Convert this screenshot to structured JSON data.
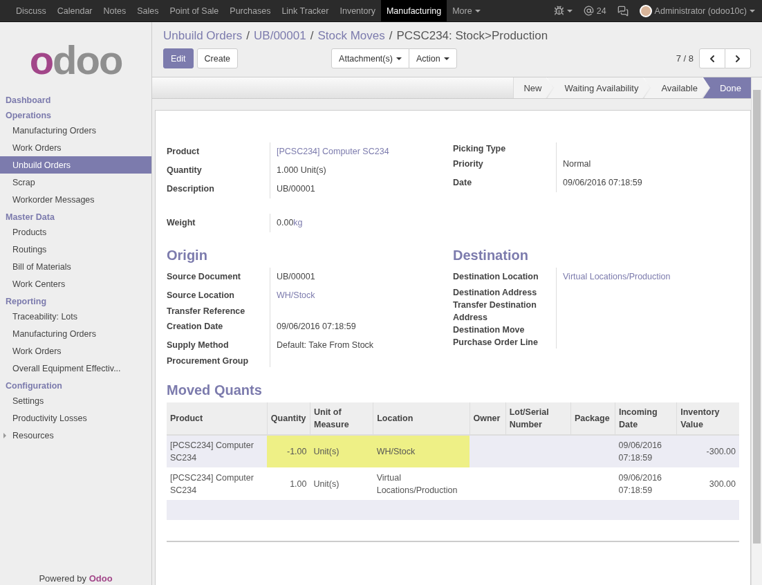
{
  "top_menu": [
    {
      "label": "Discuss",
      "selected": false
    },
    {
      "label": "Calendar",
      "selected": false
    },
    {
      "label": "Notes",
      "selected": false
    },
    {
      "label": "Sales",
      "selected": false
    },
    {
      "label": "Point of Sale",
      "selected": false
    },
    {
      "label": "Purchases",
      "selected": false
    },
    {
      "label": "Link Tracker",
      "selected": false
    },
    {
      "label": "Inventory",
      "selected": false
    },
    {
      "label": "Manufacturing",
      "selected": true
    },
    {
      "label": "More",
      "selected": false
    }
  ],
  "systray": {
    "mentions": "24",
    "user": "Administrator (odoo10c)"
  },
  "logo": "odoo",
  "sidebar": [
    {
      "title": "Dashboard"
    },
    {
      "title": "Operations",
      "items": [
        {
          "label": "Manufacturing Orders",
          "selected": false
        },
        {
          "label": "Work Orders",
          "selected": false
        },
        {
          "label": "Unbuild Orders",
          "selected": true
        },
        {
          "label": "Scrap",
          "selected": false
        },
        {
          "label": "Workorder Messages",
          "selected": false
        }
      ]
    },
    {
      "title": "Master Data",
      "items": [
        {
          "label": "Products",
          "selected": false
        },
        {
          "label": "Routings",
          "selected": false
        },
        {
          "label": "Bill of Materials",
          "selected": false
        },
        {
          "label": "Work Centers",
          "selected": false
        }
      ]
    },
    {
      "title": "Reporting",
      "items": [
        {
          "label": "Traceability: Lots",
          "selected": false
        },
        {
          "label": "Manufacturing Orders",
          "selected": false
        },
        {
          "label": "Work Orders",
          "selected": false
        },
        {
          "label": "Overall Equipment Effectiv...",
          "selected": false
        }
      ]
    },
    {
      "title": "Configuration",
      "items": [
        {
          "label": "Settings",
          "selected": false
        },
        {
          "label": "Productivity Losses",
          "selected": false
        },
        {
          "label": "Resources",
          "selected": false,
          "expandable": true
        }
      ]
    }
  ],
  "powered_by": {
    "text": "Powered by",
    "brand": "Odoo"
  },
  "breadcrumb_separator": "/",
  "breadcrumb": [
    {
      "label": "Unbuild Orders",
      "link": true
    },
    {
      "label": "UB/00001",
      "link": true
    },
    {
      "label": "Stock Moves",
      "link": true
    },
    {
      "label": "PCSC234: Stock>Production",
      "link": false
    }
  ],
  "buttons": {
    "edit": "Edit",
    "create": "Create",
    "attachments": "Attachment(s)",
    "action": "Action"
  },
  "pager": "7 / 8",
  "status_steps": [
    {
      "label": "New",
      "selected": false
    },
    {
      "label": "Waiting Availability",
      "selected": false
    },
    {
      "label": "Available",
      "selected": false
    },
    {
      "label": "Done",
      "selected": true
    }
  ],
  "groups": [
    {
      "fields": [
        {
          "label": "Product",
          "value": "[PCSC234] Computer SC234",
          "link": true
        },
        {
          "label": "Quantity",
          "value": "1.000 Unit(s)",
          "link": false
        },
        {
          "label": "Description",
          "value": "UB/00001",
          "link": false
        }
      ]
    },
    {
      "fields": [
        {
          "label": "Picking Type"
        },
        {
          "label": "Priority",
          "value": "Normal",
          "link": false
        },
        {
          "label": "Date",
          "value": "09/06/2016 07:18:59",
          "link": false
        }
      ]
    },
    {
      "fields": [
        {
          "label": "Weight",
          "value": "0.00",
          "unit": "kg",
          "link": false
        }
      ]
    },
    {
      "title": "Origin",
      "fields": [
        {
          "label": "Source Document",
          "value": "UB/00001",
          "link": false
        },
        {
          "label": "Source Location",
          "value": "WH/Stock",
          "link": true
        },
        {
          "label": "Transfer Reference"
        },
        {
          "label": "Creation Date",
          "value": "09/06/2016 07:18:59",
          "link": false
        },
        {
          "label": "Supply Method",
          "value": "Default: Take From Stock",
          "link": false
        },
        {
          "label": "Procurement Group"
        }
      ]
    },
    {
      "title": "Destination",
      "fields": [
        {
          "label": "Destination Location",
          "value": "Virtual Locations/Production",
          "link": true
        },
        {
          "label": "Destination Address"
        },
        {
          "label": "Transfer Destination Address"
        },
        {
          "label": "Destination Move"
        },
        {
          "label": "Purchase Order Line"
        }
      ]
    }
  ],
  "moved_quants": {
    "title": "Moved Quants",
    "columns": [
      "Product",
      "Quantity",
      "Unit of Measure",
      "Location",
      "Owner",
      "Lot/Serial Number",
      "Package",
      "Incoming Date",
      "Inventory Value"
    ],
    "rows": [
      {
        "cells": [
          "[PCSC234] Computer SC234",
          "-1.00",
          "Unit(s)",
          "WH/Stock",
          "",
          "",
          "",
          "09/06/2016 07:18:59",
          "-300.00"
        ],
        "highlighted": true
      },
      {
        "cells": [
          "[PCSC234] Computer SC234",
          "1.00",
          "Unit(s)",
          "Virtual Locations/Production",
          "",
          "",
          "",
          "09/06/2016 07:18:59",
          "300.00"
        ],
        "highlighted": false
      }
    ]
  }
}
